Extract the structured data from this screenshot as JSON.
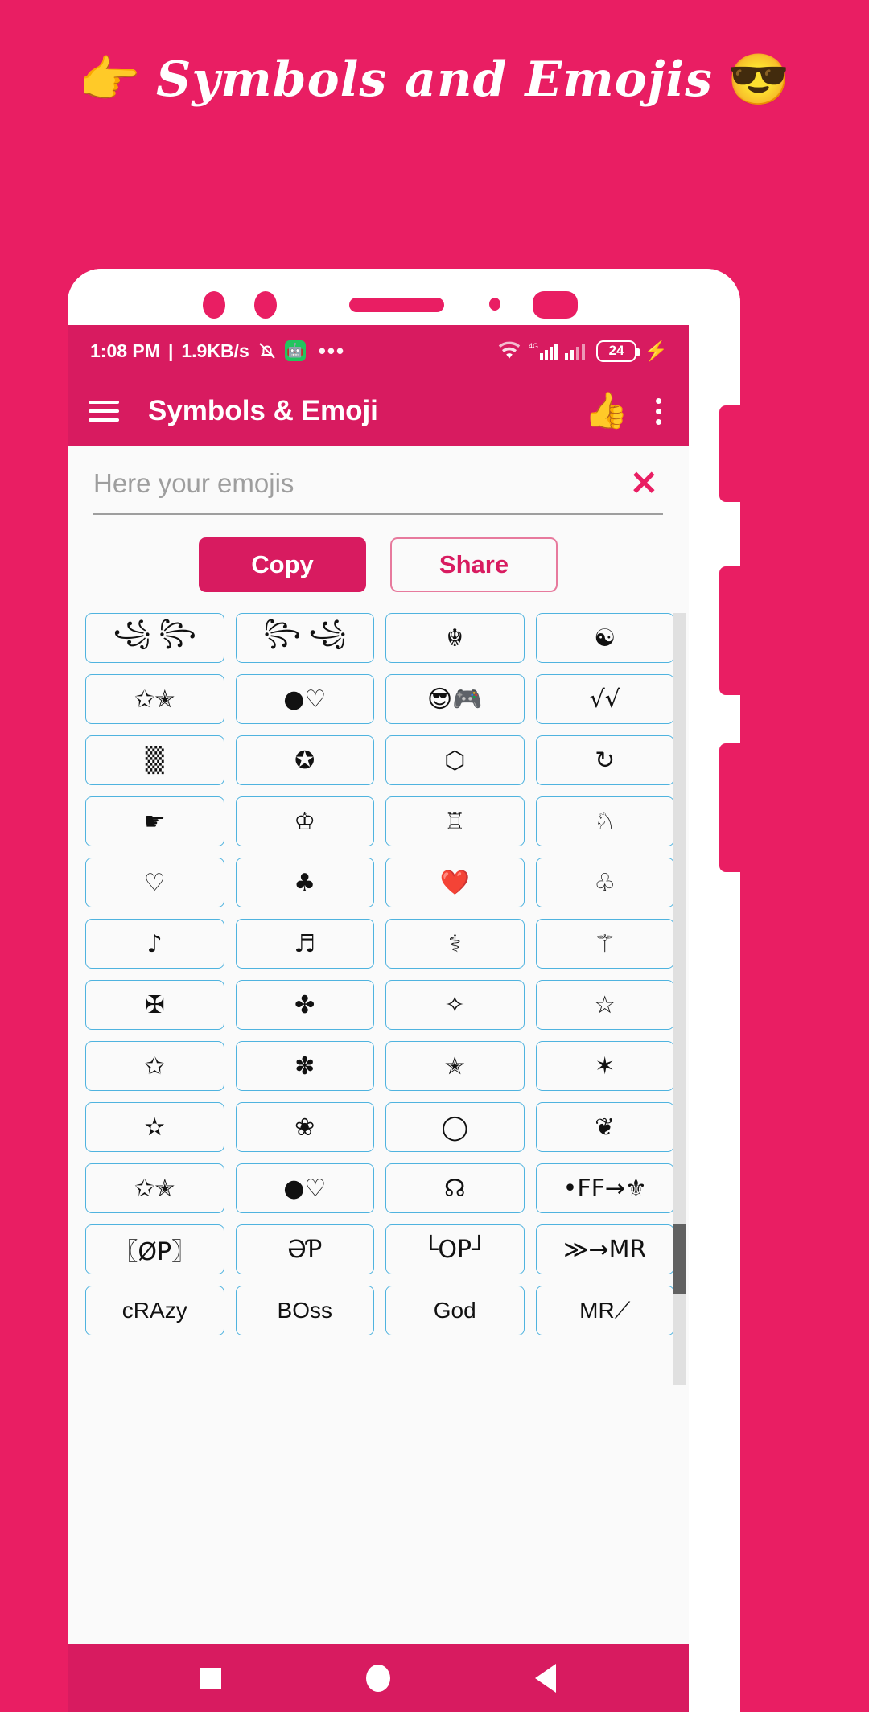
{
  "promo": {
    "left_emoji": "👉",
    "title": "Symbols and Emojis",
    "right_emoji": "😎",
    "background_color": "#E91E63"
  },
  "status_bar": {
    "time": "1:08 PM",
    "separator": "|",
    "network_speed": "1.9KB/s",
    "mute_icon": "🔕",
    "android_icon": "🤖",
    "overflow_dots": "•••",
    "wifi_icon": "wifi-icon",
    "signal_label": "4G",
    "battery_level": "24",
    "charging_icon": "⚡"
  },
  "app_bar": {
    "menu_icon": "hamburger-icon",
    "title": "Symbols & Emoji",
    "like_icon": "👍",
    "overflow_icon": "kebab-icon",
    "background_color": "#D81B60"
  },
  "search": {
    "value": "",
    "placeholder": "Here your emojis",
    "clear_label": "✕"
  },
  "actions": {
    "copy_label": "Copy",
    "share_label": "Share",
    "accent_color": "#D81B60"
  },
  "grid": {
    "border_color": "#4FB3DF",
    "cells": [
      "꧁ ꧂",
      "꧂ ꧁",
      "☬",
      "☯",
      "✩✭",
      "●♡",
      "😎🎮",
      "√√",
      "▒",
      "✪",
      "⬡",
      "↻",
      "☛",
      "♔",
      "♖",
      "♘",
      "♡",
      "♣",
      "❤️",
      "♧",
      "♪",
      "♬",
      "⚕",
      "⚚",
      "✠",
      "✤",
      "✧",
      "☆",
      "✩",
      "✽",
      "✭",
      "✶",
      "✫",
      "❀",
      "◯",
      "❦",
      "✩✭",
      "●♡",
      "☊",
      "•FF→⚜",
      "〖ØP〗",
      "ƏƤ",
      "└OP┘",
      "≫→MR",
      "cRAzy",
      "BOss",
      "God",
      "MR⟋"
    ]
  },
  "scrollbar": {
    "track_color": "#e0e0e0",
    "thumb_color": "#616161"
  },
  "nav_bar": {
    "recents_label": "recents-square-icon",
    "home_label": "home-circle-icon",
    "back_label": "back-triangle-icon",
    "background_color": "#D81B60"
  }
}
